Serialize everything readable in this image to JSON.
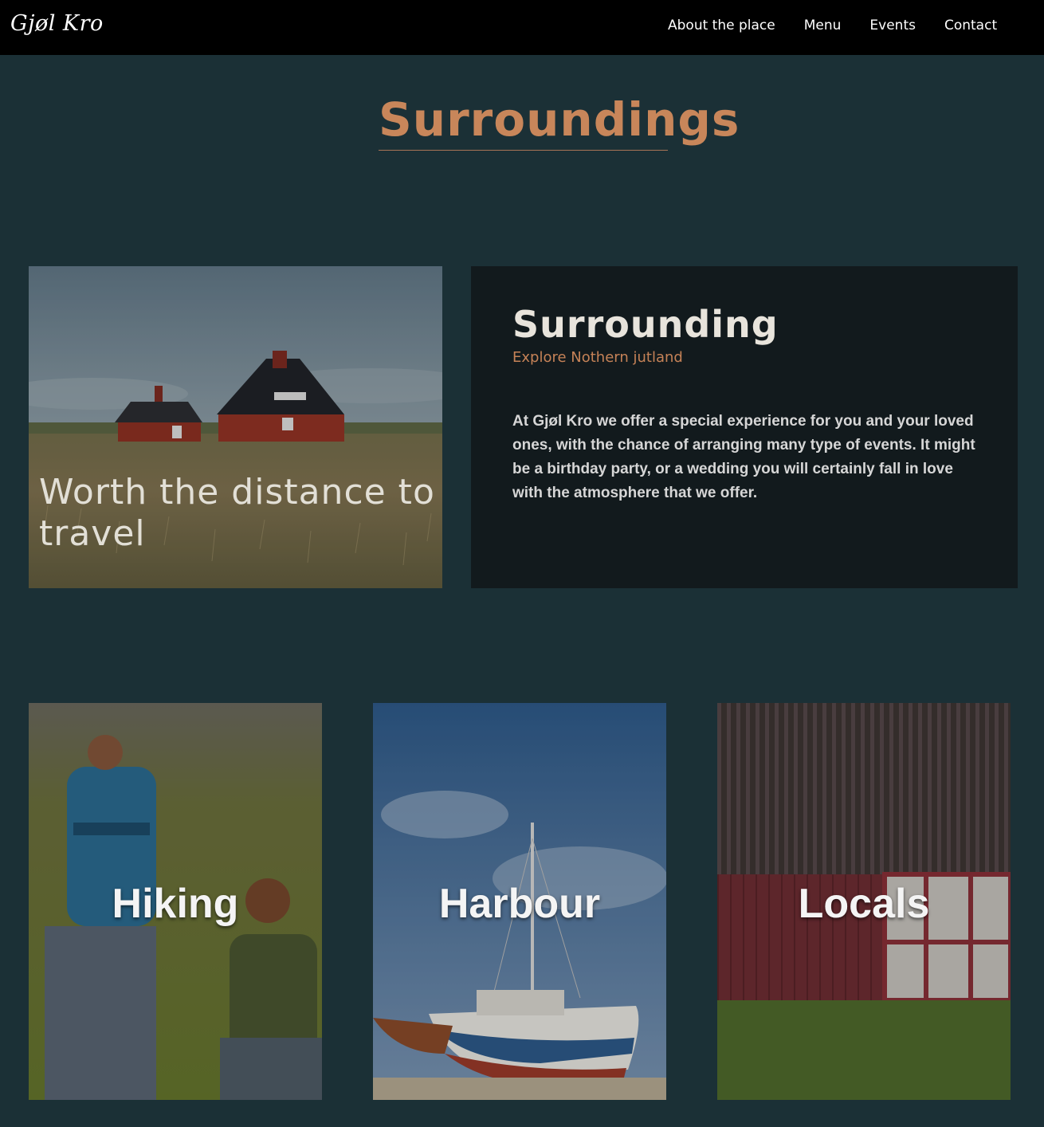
{
  "nav": {
    "logo": "Gjøl Kro",
    "links": [
      "About the place",
      "Menu",
      "Events",
      "Contact"
    ]
  },
  "section": {
    "title": "Surroundings"
  },
  "feature": {
    "caption": "Worth the distance to travel"
  },
  "info": {
    "heading": "Surrounding",
    "subheading": "Explore Nothern jutland",
    "body": "At Gjøl Kro we offer a special experience for you and your loved ones, with the chance of arranging many type of events. It might be a birthday party, or a wedding you will certainly fall in love with the atmosphere that we offer."
  },
  "cards": [
    {
      "label": "Hiking"
    },
    {
      "label": "Harbour"
    },
    {
      "label": "Locals"
    }
  ],
  "colors": {
    "page_background": "#1b3036",
    "nav_background": "#000000",
    "accent": "#c8865a",
    "panel_background": "#121a1d"
  }
}
